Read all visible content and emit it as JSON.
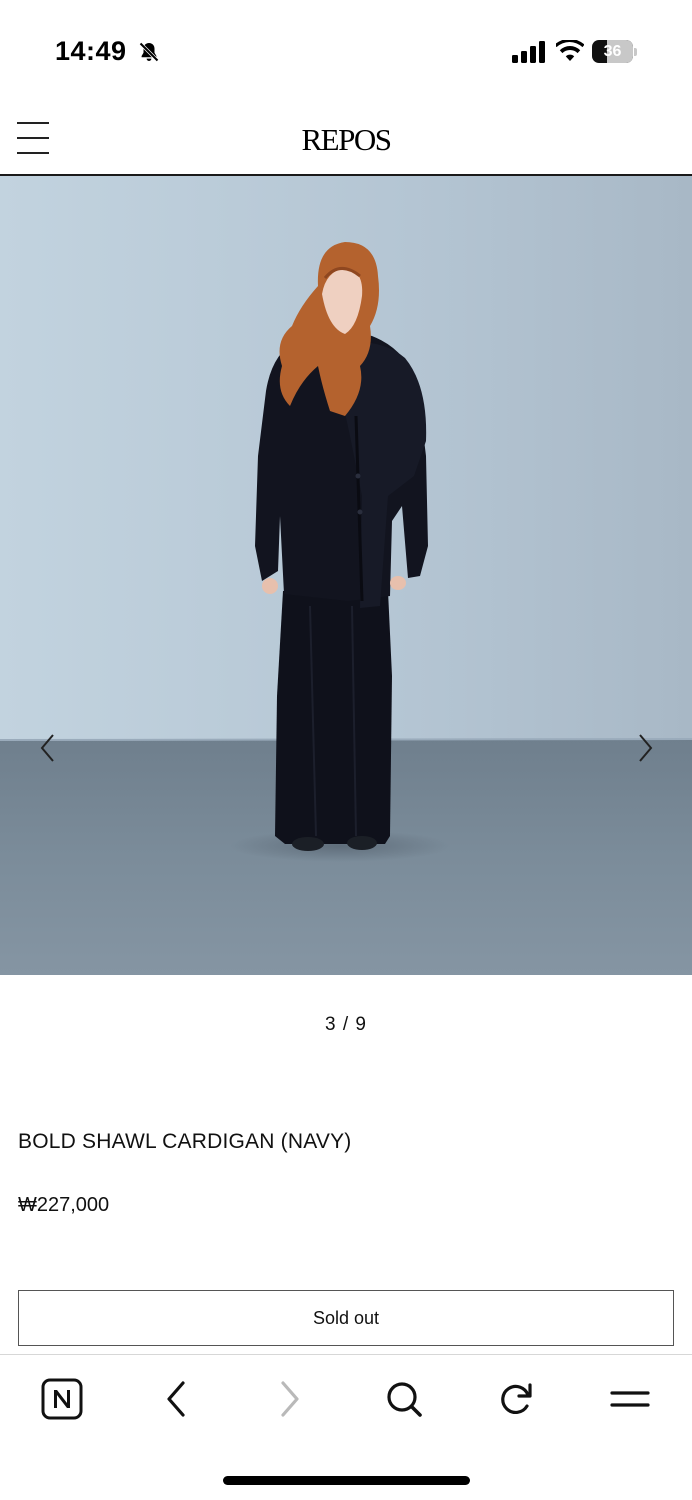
{
  "status_bar": {
    "time": "14:49",
    "battery_level": "36",
    "icons": [
      "bell-slash-icon",
      "signal-icon",
      "wifi-icon",
      "battery-icon"
    ]
  },
  "header": {
    "brand": "REPOS",
    "menu_icon": "hamburger-menu-icon"
  },
  "carousel": {
    "indicator": "3 / 9",
    "prev_icon": "chevron-left-icon",
    "next_icon": "chevron-right-icon"
  },
  "product": {
    "title": "BOLD SHAWL CARDIGAN (NAVY)",
    "price": "₩227,000",
    "button_label": "Sold out"
  },
  "browser_toolbar": {
    "items": [
      "naver-home-icon",
      "back-icon",
      "forward-icon",
      "search-icon",
      "reload-icon",
      "menu-icon"
    ]
  },
  "colors": {
    "wall": "#b9c9d6",
    "floor": "#7a8a99",
    "garment": "#12141f",
    "hair": "#b4622e"
  }
}
